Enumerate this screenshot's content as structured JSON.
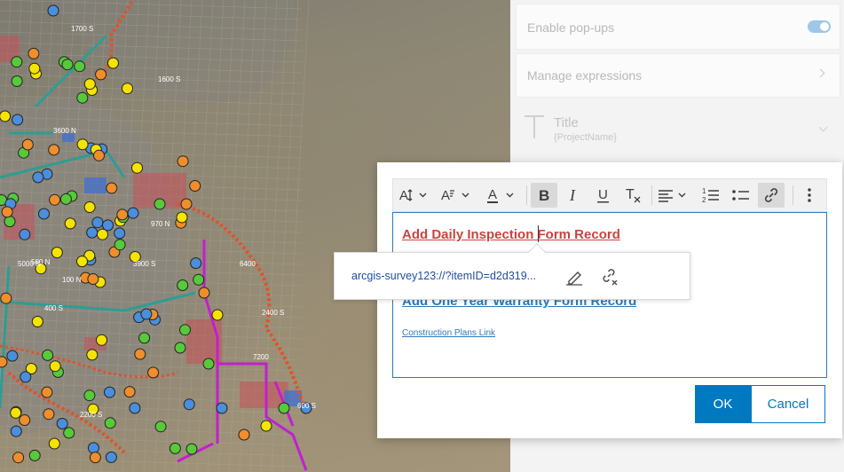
{
  "settings": {
    "enable_popups_label": "Enable pop-ups",
    "popups_enabled": true,
    "manage_expressions_label": "Manage expressions",
    "title_label": "Title",
    "title_value": "{ProjectName}"
  },
  "editor": {
    "content": {
      "link1": "Add Daily Inspection Form Record",
      "link2": "Add One Year Warranty Form Record",
      "link3": "Construction Plans Link"
    },
    "toolbar": {
      "icons": [
        "font-size-icon",
        "heading-icon",
        "font-color-icon",
        "bold-icon",
        "italic-icon",
        "underline-icon",
        "remove-format-icon",
        "align-icon",
        "numbered-list-icon",
        "bullet-list-icon",
        "link-icon",
        "more-icon"
      ],
      "active": [
        "bold-icon",
        "link-icon"
      ]
    }
  },
  "link_popover": {
    "url": "arcgis-survey123://?itemID=d2d319..."
  },
  "buttons": {
    "ok": "OK",
    "cancel": "Cancel"
  },
  "map": {
    "labels": [
      "1600 S",
      "3900 S",
      "5000 N",
      "3600 N",
      "6400",
      "2400 S",
      "7200",
      "1700 S",
      "970 N",
      "500 N",
      "100 N",
      "400 S",
      "2200 S",
      "600 S"
    ]
  },
  "colors": {
    "accent": "#0079c1",
    "link_red": "#c7443f",
    "link_blue": "#2f79b9"
  }
}
